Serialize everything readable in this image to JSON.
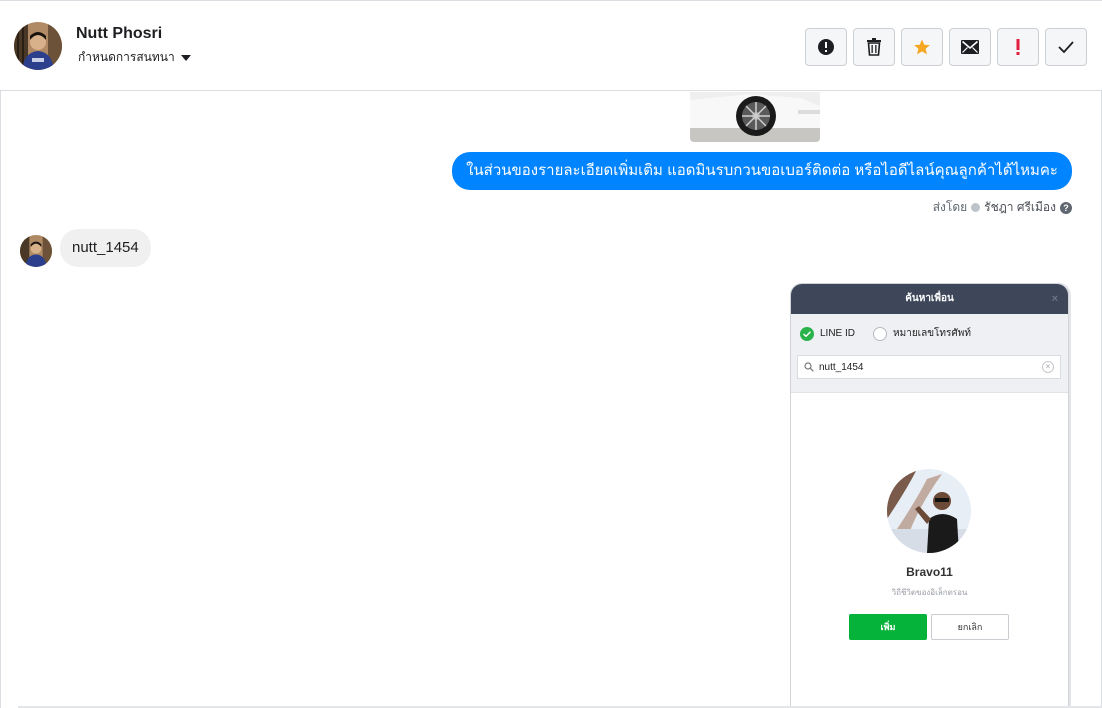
{
  "header": {
    "contact_name": "Nutt Phosri",
    "assign_label": "กำหนดการสนทนา",
    "actions": [
      {
        "icon": "alert-circle-icon",
        "label": "Mark as spam",
        "color": "#1c1e21"
      },
      {
        "icon": "trash-icon",
        "label": "Delete",
        "color": "#1c1e21"
      },
      {
        "icon": "star-icon",
        "label": "Follow up",
        "color": "#f5a623"
      },
      {
        "icon": "envelope-icon",
        "label": "Mark as unread",
        "color": "#1c1e21"
      },
      {
        "icon": "exclamation-icon",
        "label": "Priority",
        "color": "#e41e3f"
      },
      {
        "icon": "check-icon",
        "label": "Mark as done",
        "color": "#1c1e21"
      }
    ]
  },
  "conversation": {
    "outgoing_message": "ในส่วนของรายละเอียดเพิ่มเติม แอดมินรบกวนขอเบอร์ติดต่อ หรือไอดีไลน์คุณลูกค้าได้ไหมคะ",
    "sent_by_prefix": "ส่งโดย",
    "sent_by_agent": "รัชฎา ศรีเมือง",
    "incoming_message": "nutt_1454",
    "outgoing_color": "#0084ff"
  },
  "line_screenshot": {
    "title": "ค้นหาเพื่อน",
    "close": "×",
    "option_line_id": "LINE ID",
    "option_phone": "หมายเลขโทรศัพท์",
    "search_value": "nutt_1454",
    "friend_name": "Bravo11",
    "friend_status": "วิถีชีวิตของอิเล็กตรอน",
    "add_label": "เพิ่ม",
    "cancel_label": "ยกเลิก",
    "accent": "#06b33a"
  }
}
